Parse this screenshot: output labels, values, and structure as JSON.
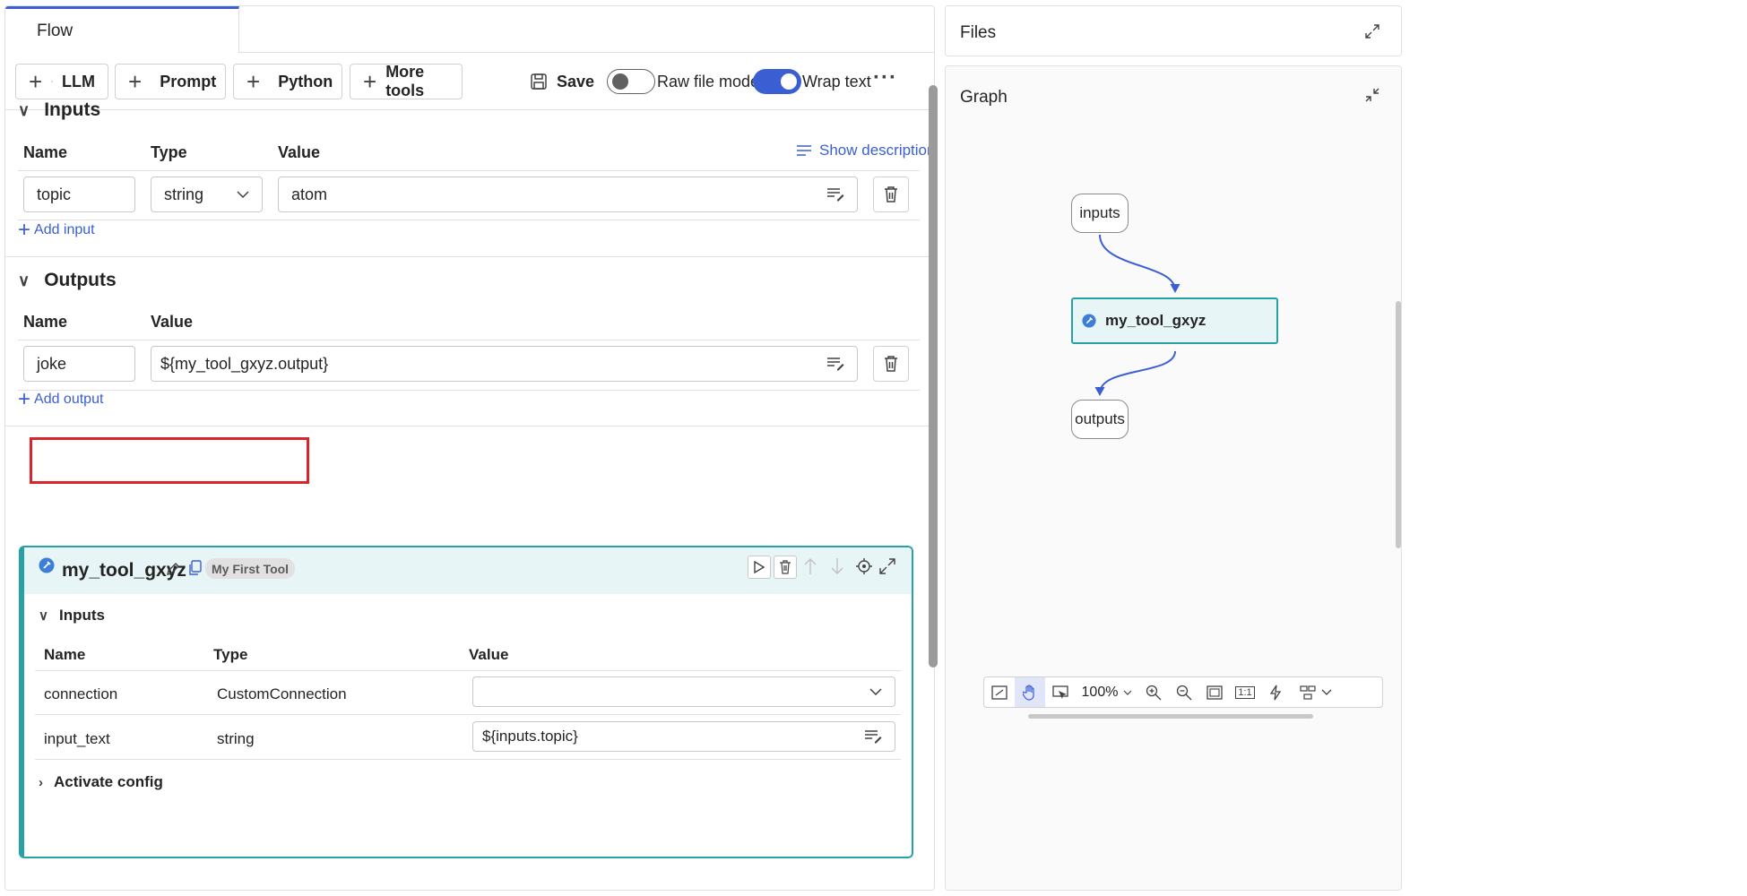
{
  "tab": {
    "label": "Flow"
  },
  "toolbar": {
    "llm_label": "LLM",
    "prompt_label": "Prompt",
    "python_label": "Python",
    "more_tools_label": "More tools",
    "save_label": "Save",
    "raw_file_mode_label": "Raw file mode",
    "raw_file_mode_on": false,
    "wrap_text_label": "Wrap text",
    "wrap_text_on": true,
    "more_icon": "ellipsis-icon"
  },
  "inputs_section": {
    "title": "Inputs",
    "col_name": "Name",
    "col_type": "Type",
    "col_value": "Value",
    "show_description": "Show description",
    "row": {
      "name": "topic",
      "type": "string",
      "value": "atom"
    },
    "add_label": "Add input"
  },
  "outputs_section": {
    "title": "Outputs",
    "col_name": "Name",
    "col_value": "Value",
    "row": {
      "name": "joke",
      "value": "${my_tool_gxyz.output}"
    },
    "add_label": "Add output"
  },
  "node": {
    "name": "my_tool_gxyz",
    "badge": "My First Tool",
    "inputs_title": "Inputs",
    "col_name": "Name",
    "col_type": "Type",
    "col_value": "Value",
    "rows": [
      {
        "name": "connection",
        "type": "CustomConnection",
        "value": ""
      },
      {
        "name": "input_text",
        "type": "string",
        "value": "${inputs.topic}"
      }
    ],
    "activate_config": "Activate config"
  },
  "files_panel": {
    "title": "Files"
  },
  "graph_panel": {
    "title": "Graph",
    "nodes": {
      "inputs": "inputs",
      "tool": "my_tool_gxyz",
      "outputs": "outputs"
    },
    "zoom": "100%"
  },
  "colors": {
    "accent": "#3b5fd3",
    "node_border": "#27a0a8",
    "node_bg": "#e8f5f6",
    "highlight": "#d9242c"
  }
}
